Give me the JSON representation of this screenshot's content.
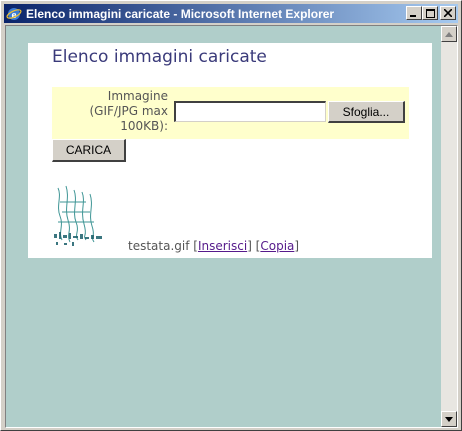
{
  "window": {
    "title": "Elenco immagini caricate - Microsoft Internet Explorer",
    "app_icon": "ie-icon",
    "controls": {
      "minimize": "_",
      "maximize": "□",
      "close": "×"
    }
  },
  "page": {
    "title": "Elenco immagini caricate",
    "upload": {
      "label_line1": "Immagine",
      "label_line2": "(GIF/JPG max",
      "label_line3": "100KB):",
      "file_value": "",
      "browse_label": "Sfoglia...",
      "submit_label": "CARICA"
    },
    "images": [
      {
        "filename": "testata.gif",
        "insert_link": "Inserisci",
        "copy_link": "Copia"
      }
    ]
  },
  "colors": {
    "titlebar_start": "#0a246a",
    "titlebar_end": "#a6caf0",
    "page_background": "#b0ceca",
    "upload_box": "#ffffcc",
    "title_text": "#3a3a7a",
    "visited_link": "#551a8b"
  }
}
